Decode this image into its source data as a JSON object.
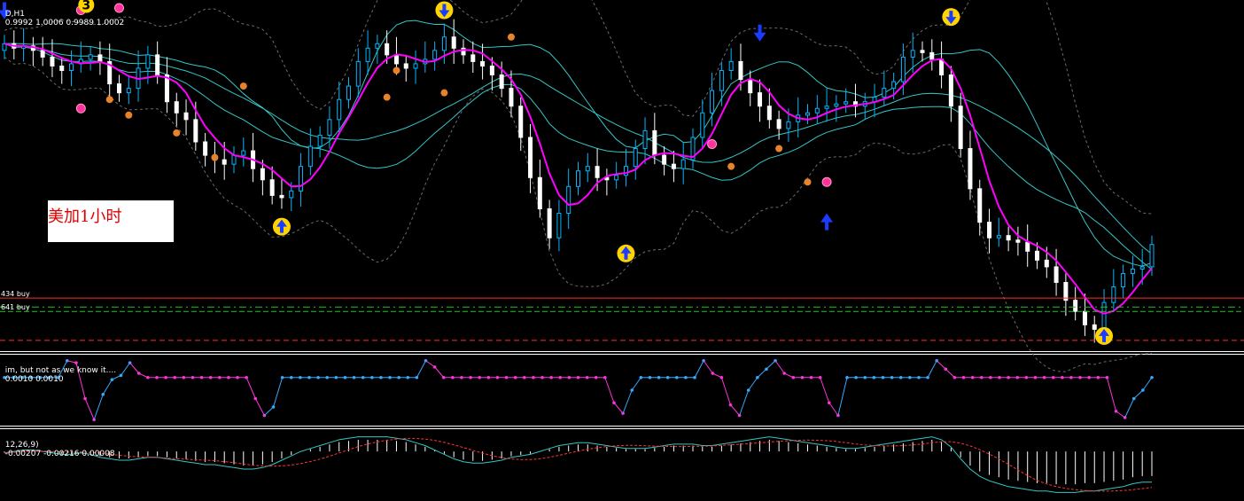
{
  "header": {
    "symbol_text": "D,H1",
    "ohlc_text": "0.9992 1.0006 0.9989 1.0002"
  },
  "annotation": {
    "text": "美加1小时"
  },
  "level_labels": [
    "434 buy",
    "641 buy"
  ],
  "oscillator": {
    "title": "im, but not as we know it....",
    "values_text": "0.0010 0.0010"
  },
  "macd": {
    "title": "12,26,9)",
    "values_text": "-0.00207 -0.00216 0.00008"
  },
  "badge": {
    "text": "3"
  },
  "colors": {
    "bull": "#00b7ff",
    "bear": "#ffffff",
    "ma_fast": "#ff00ff",
    "ma_band": "#35c6c6",
    "bollinger": "#6b6b6b",
    "signal_ring": "#ffd400",
    "signal_arrow": "#1a3cff",
    "level_red": "#ff2a2a",
    "level_green": "#25c425",
    "osc_high": "#33aaff",
    "osc_low": "#ff33dd"
  },
  "chart_data": [
    {
      "type": "line",
      "title": "D,H1",
      "series": [
        {
          "name": "",
          "values": [
            1.0092,
            1.009,
            1.0091,
            1.0089,
            1.0086,
            1.0082,
            1.008,
            1.0083,
            1.0085,
            1.0087,
            1.0084,
            1.0074,
            1.007,
            1.0072,
            1.0081,
            1.0087,
            1.0078,
            1.0066,
            1.0061,
            1.0058,
            1.0048,
            1.0042,
            1.004,
            1.0038,
            1.0042,
            1.0044,
            1.0036,
            1.0031,
            1.0024,
            1.0023,
            1.0026,
            1.0037,
            1.0046,
            1.0051,
            1.0058,
            1.0067,
            1.0073,
            1.0084,
            1.009,
            1.0092,
            1.0087,
            1.0083,
            1.0081,
            1.0083,
            1.0085,
            1.0089,
            1.0095,
            1.009,
            1.0087,
            1.0084,
            1.0082,
            1.0078,
            1.0072,
            1.0064,
            1.005,
            1.0032,
            1.0018,
            1.0005,
            1.0016,
            1.0028,
            1.0035,
            1.0037,
            1.0032,
            1.0031,
            1.0033,
            1.0037,
            1.0045,
            1.0053,
            1.0042,
            1.0038,
            1.0036,
            1.004,
            1.005,
            1.0061,
            1.0071,
            1.008,
            1.0084,
            1.0076,
            1.007,
            1.0064,
            1.0058,
            1.0054,
            1.0057,
            1.006,
            1.0061,
            1.0063,
            1.0064,
            1.0065,
            1.0066,
            1.0064,
            1.0066,
            1.0068,
            1.0072,
            1.0075,
            1.0086,
            1.0089,
            1.0088,
            1.0085,
            1.0078,
            1.0064,
            1.0045,
            1.0027,
            1.0012,
            1.0005,
            1.0006,
            1.0004,
            1.0003,
            0.9999,
            0.9995,
            0.9992,
            0.9985,
            0.9977,
            0.9972,
            0.9966,
            0.9964,
            0.9976,
            0.9983,
            0.9989,
            0.9991,
            0.9992,
            1.0002
          ]
        }
      ],
      "levels": [
        0.9978,
        0.9974,
        0.9972,
        0.9959
      ],
      "ylim": [
        0.9955,
        1.011
      ]
    },
    {
      "type": "line",
      "title": "im, but not as we know it....",
      "series": [
        {
          "name": "",
          "values": [
            0.001,
            0.001,
            0.001,
            0.001,
            0.001,
            0.001,
            0.001,
            0.0018,
            0.0017,
            0.0,
            -0.001,
            0.0002,
            0.0009,
            0.0011,
            0.0017,
            0.0012,
            0.001,
            0.001,
            0.001,
            0.001,
            0.001,
            0.001,
            0.001,
            0.001,
            0.001,
            0.001,
            0.001,
            0.001,
            0.0,
            -0.0008,
            -0.0004,
            0.001,
            0.001,
            0.001,
            0.001,
            0.001,
            0.001,
            0.001,
            0.001,
            0.001,
            0.001,
            0.001,
            0.001,
            0.001,
            0.001,
            0.001,
            0.001,
            0.0018,
            0.0015,
            0.001,
            0.001,
            0.001,
            0.001,
            0.001,
            0.001,
            0.001,
            0.001,
            0.001,
            0.001,
            0.001,
            0.001,
            0.001,
            0.001,
            0.001,
            0.001,
            0.001,
            0.001,
            0.001,
            -0.0002,
            -0.0007,
            0.0004,
            0.001,
            0.001,
            0.001,
            0.001,
            0.001,
            0.001,
            0.001,
            0.0018,
            0.0012,
            0.001,
            -0.0003,
            -0.0008,
            0.0004,
            0.001,
            0.0014,
            0.0018,
            0.0012,
            0.001,
            0.001,
            0.001,
            0.001,
            -0.0002,
            -0.0008,
            0.001,
            0.001,
            0.001,
            0.001,
            0.001,
            0.001,
            0.001,
            0.001,
            0.001,
            0.001,
            0.0018,
            0.0014,
            0.001,
            0.001,
            0.001,
            0.001,
            0.001,
            0.001,
            0.001,
            0.001,
            0.001,
            0.001,
            0.001,
            0.001,
            0.001,
            0.001,
            0.001,
            0.001,
            0.001,
            0.001,
            -0.0006,
            -0.0009,
            0.0,
            0.0004,
            0.001
          ]
        }
      ],
      "ylim": [
        -0.0012,
        0.002
      ]
    },
    {
      "type": "line",
      "title": "12,26,9)",
      "series": [
        {
          "name": "",
          "values": [
            -0.0001,
            0.0,
            0.0001,
            0.0001,
            0.0,
            -0.0001,
            -0.0002,
            -0.0002,
            -0.0001,
            -0.0002,
            -0.0004,
            -0.0005,
            -0.0006,
            -0.0006,
            -0.0005,
            -0.0004,
            -0.0004,
            -0.0005,
            -0.0006,
            -0.0007,
            -0.0008,
            -0.0009,
            -0.0009,
            -0.001,
            -0.0011,
            -0.0012,
            -0.0012,
            -0.0011,
            -0.0009,
            -0.0006,
            -0.0003,
            0.0,
            0.0002,
            0.0004,
            0.0006,
            0.0008,
            0.0009,
            0.001,
            0.001,
            0.001,
            0.001,
            0.0009,
            0.0008,
            0.0006,
            0.0004,
            0.0001,
            -0.0002,
            -0.0005,
            -0.0007,
            -0.0008,
            -0.0008,
            -0.0007,
            -0.0006,
            -0.0004,
            -0.0003,
            -0.0002,
            0.0,
            0.0002,
            0.0004,
            0.0005,
            0.0006,
            0.0006,
            0.0005,
            0.0004,
            0.0003,
            0.0002,
            0.0002,
            0.0002,
            0.0003,
            0.0004,
            0.0005,
            0.0005,
            0.0005,
            0.0004,
            0.0004,
            0.0005,
            0.0006,
            0.0007,
            0.0008,
            0.0009,
            0.001,
            0.0009,
            0.0008,
            0.0007,
            0.0006,
            0.0005,
            0.0004,
            0.0003,
            0.0002,
            0.0002,
            0.0003,
            0.0004,
            0.0005,
            0.0006,
            0.0007,
            0.0008,
            0.0009,
            0.001,
            0.0008,
            0.0003,
            -0.0005,
            -0.0012,
            -0.0017,
            -0.002,
            -0.0022,
            -0.0024,
            -0.0025,
            -0.0026,
            -0.0027,
            -0.0027,
            -0.0028,
            -0.0028,
            -0.0028,
            -0.0027,
            -0.0027,
            -0.0026,
            -0.0025,
            -0.0024,
            -0.0022,
            -0.0021,
            -0.0021
          ]
        }
      ],
      "ylim": [
        -0.0032,
        0.0014
      ]
    }
  ]
}
